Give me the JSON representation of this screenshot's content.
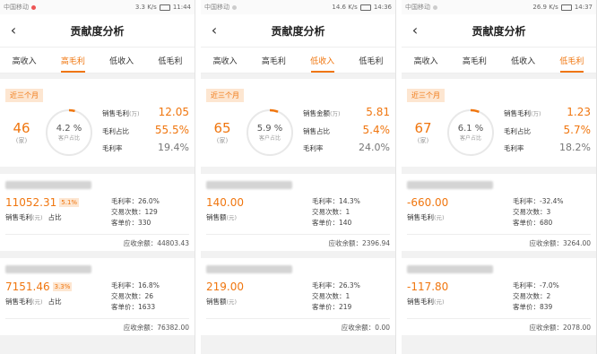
{
  "screens": [
    {
      "status": {
        "left": "中国移动",
        "speed": "3.3 K/s",
        "time": "11:44"
      },
      "title": "贡献度分析",
      "tabs": [
        "高收入",
        "高毛利",
        "低收入",
        "低毛利"
      ],
      "active_tab": 1,
      "period": "近三个月",
      "count": "46",
      "count_unit": "(家)",
      "ring_pct": "4.2 %",
      "ring_label": "客户占比",
      "ring_fraction": 0.042,
      "m1_label": "销售毛利",
      "m1_unit": "(万)",
      "m1_value": "12.05",
      "m2_label": "毛利占比",
      "m2_value": "55.5%",
      "m3_label": "毛利率",
      "m3_value": "19.4%",
      "cards": [
        {
          "value": "11052.31",
          "badge": "5.1%",
          "value_label": "销售毛利",
          "value_unit": "(元)",
          "ratio_label": "占比",
          "margin": "毛利率：26.0%",
          "trades": "交易次数：129",
          "unit_price": "客单价：330",
          "receivable": "应收余额：44803.43"
        },
        {
          "value": "7151.46",
          "badge": "3.3%",
          "value_label": "销售毛利",
          "value_unit": "(元)",
          "ratio_label": "占比",
          "margin": "毛利率：16.8%",
          "trades": "交易次数：26",
          "unit_price": "客单价：1633",
          "receivable": "应收余额：76382.00"
        }
      ]
    },
    {
      "status": {
        "left": "中国移动",
        "speed": "14.6 K/s",
        "time": "14:36"
      },
      "title": "贡献度分析",
      "tabs": [
        "高收入",
        "高毛利",
        "低收入",
        "低毛利"
      ],
      "active_tab": 2,
      "period": "近三个月",
      "count": "65",
      "count_unit": "(家)",
      "ring_pct": "5.9 %",
      "ring_label": "客户占比",
      "ring_fraction": 0.059,
      "m1_label": "销售金额",
      "m1_unit": "(万)",
      "m1_value": "5.81",
      "m2_label": "销售占比",
      "m2_value": "5.4%",
      "m3_label": "毛利率",
      "m3_value": "24.0%",
      "cards": [
        {
          "value": "140.00",
          "badge": "",
          "value_label": "销售额",
          "value_unit": "(元)",
          "ratio_label": "",
          "margin": "毛利率：14.3%",
          "trades": "交易次数：1",
          "unit_price": "客单价：140",
          "receivable": "应收余额：2396.94"
        },
        {
          "value": "219.00",
          "badge": "",
          "value_label": "销售额",
          "value_unit": "(元)",
          "ratio_label": "",
          "margin": "毛利率：26.3%",
          "trades": "交易次数：1",
          "unit_price": "客单价：219",
          "receivable": "应收余额：0.00"
        }
      ]
    },
    {
      "status": {
        "left": "中国移动",
        "speed": "26.9 K/s",
        "time": "14:37"
      },
      "title": "贡献度分析",
      "tabs": [
        "高收入",
        "高毛利",
        "低收入",
        "低毛利"
      ],
      "active_tab": 3,
      "period": "近三个月",
      "count": "67",
      "count_unit": "(家)",
      "ring_pct": "6.1 %",
      "ring_label": "客户占比",
      "ring_fraction": 0.061,
      "m1_label": "销售毛利",
      "m1_unit": "(万)",
      "m1_value": "1.23",
      "m2_label": "毛利占比",
      "m2_value": "5.7%",
      "m3_label": "毛利率",
      "m3_value": "18.2%",
      "cards": [
        {
          "value": "-660.00",
          "badge": "",
          "value_label": "销售毛利",
          "value_unit": "(元)",
          "ratio_label": "",
          "margin": "毛利率：-32.4%",
          "trades": "交易次数：3",
          "unit_price": "客单价：680",
          "receivable": "应收余额：3264.00"
        },
        {
          "value": "-117.80",
          "badge": "",
          "value_label": "销售毛利",
          "value_unit": "(元)",
          "ratio_label": "",
          "margin": "毛利率：-7.0%",
          "trades": "交易次数：2",
          "unit_price": "客单价：839",
          "receivable": "应收余额：2078.00"
        }
      ]
    }
  ]
}
